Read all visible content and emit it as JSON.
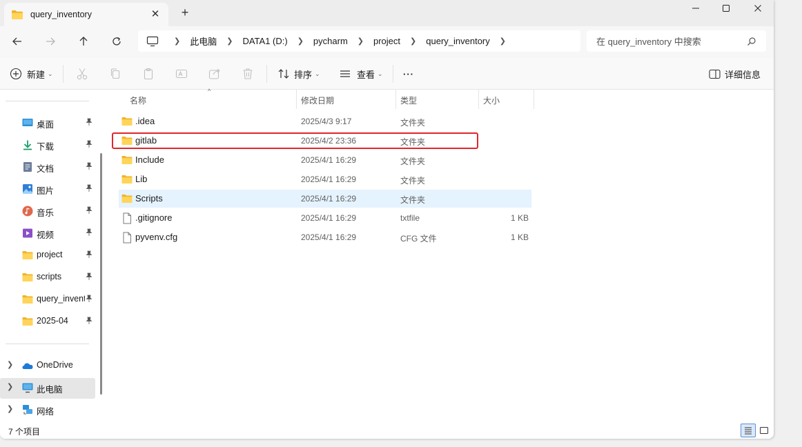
{
  "window": {
    "tab_title": "query_inventory",
    "close_tab_symbol": "✕",
    "new_tab_symbol": "+"
  },
  "address": {
    "crumbs": [
      "此电脑",
      "DATA1 (D:)",
      "pycharm",
      "project",
      "query_inventory"
    ],
    "search_placeholder": "在 query_inventory 中搜索"
  },
  "toolbar": {
    "new_label": "新建",
    "sort_label": "排序",
    "view_label": "查看",
    "more_label": "···",
    "details_label": "详细信息"
  },
  "sidebar": {
    "quick_access": [
      {
        "label": "桌面",
        "icon": "desktop-icon"
      },
      {
        "label": "下载",
        "icon": "download-icon"
      },
      {
        "label": "文档",
        "icon": "documents-icon"
      },
      {
        "label": "图片",
        "icon": "pictures-icon"
      },
      {
        "label": "音乐",
        "icon": "music-icon"
      },
      {
        "label": "视频",
        "icon": "videos-icon"
      },
      {
        "label": "project",
        "icon": "folder-icon"
      },
      {
        "label": "scripts",
        "icon": "folder-icon"
      },
      {
        "label": "query_inventory",
        "icon": "folder-icon"
      },
      {
        "label": "2025-04",
        "icon": "folder-icon"
      }
    ],
    "locations": [
      {
        "label": "OneDrive",
        "icon": "onedrive-icon"
      },
      {
        "label": "此电脑",
        "icon": "this-pc-icon",
        "selected": true
      },
      {
        "label": "网络",
        "icon": "network-icon"
      }
    ]
  },
  "columns": {
    "name": "名称",
    "date": "修改日期",
    "type": "类型",
    "size": "大小"
  },
  "files": [
    {
      "name": ".idea",
      "date": "2025/4/3 9:17",
      "type": "文件夹",
      "size": "",
      "kind": "folder"
    },
    {
      "name": "gitlab",
      "date": "2025/4/2 23:36",
      "type": "文件夹",
      "size": "",
      "kind": "folder",
      "highlighted": true
    },
    {
      "name": "Include",
      "date": "2025/4/1 16:29",
      "type": "文件夹",
      "size": "",
      "kind": "folder"
    },
    {
      "name": "Lib",
      "date": "2025/4/1 16:29",
      "type": "文件夹",
      "size": "",
      "kind": "folder"
    },
    {
      "name": "Scripts",
      "date": "2025/4/1 16:29",
      "type": "文件夹",
      "size": "",
      "kind": "folder",
      "hovered": true
    },
    {
      "name": ".gitignore",
      "date": "2025/4/1 16:29",
      "type": "txtfile",
      "size": "1 KB",
      "kind": "file"
    },
    {
      "name": "pyvenv.cfg",
      "date": "2025/4/1 16:29",
      "type": "CFG 文件",
      "size": "1 KB",
      "kind": "file"
    }
  ],
  "status": {
    "item_count": "7 个项目"
  },
  "colors": {
    "folder": "#f8c83c",
    "highlight_border": "#e0262a",
    "hover_row": "#e5f3ff",
    "accent": "#0067c0"
  }
}
